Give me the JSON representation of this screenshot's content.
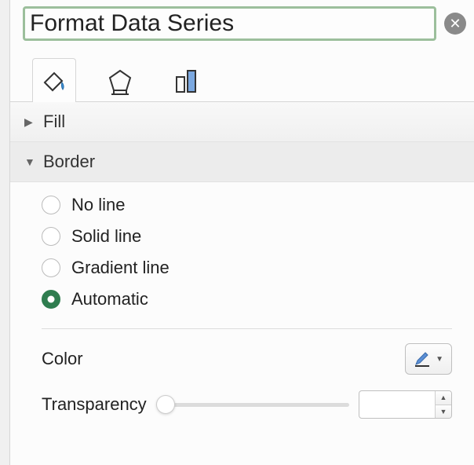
{
  "panel": {
    "title": "Format Data Series",
    "icons": {
      "close": "✕",
      "fill_line_tab": "paint-bucket",
      "effects_tab": "pentagon",
      "series_options_tab": "bar-chart"
    }
  },
  "sections": {
    "fill": {
      "label": "Fill",
      "expanded": false
    },
    "border": {
      "label": "Border",
      "expanded": true,
      "options": {
        "no_line": "No line",
        "solid_line": "Solid line",
        "gradient_line": "Gradient line",
        "automatic": "Automatic"
      },
      "selected": "automatic",
      "color_label": "Color",
      "transparency_label": "Transparency",
      "transparency_value": ""
    }
  }
}
